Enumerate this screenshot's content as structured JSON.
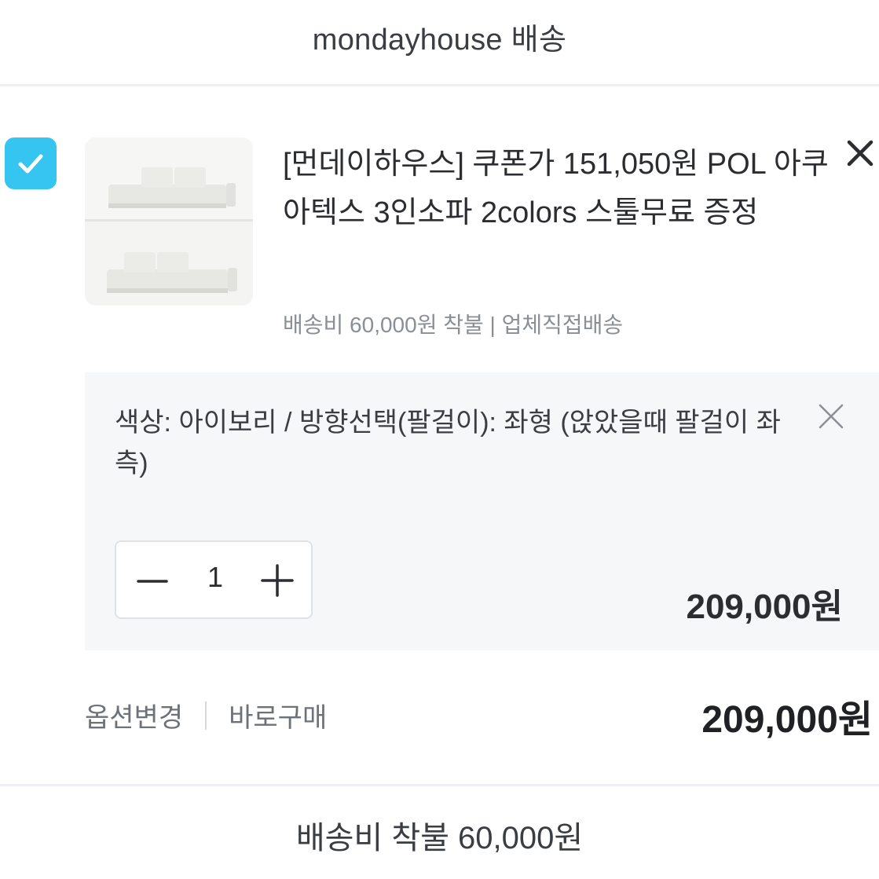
{
  "header": {
    "title": "mondayhouse 배송"
  },
  "item": {
    "checked": true,
    "thumbnail_alt": "sofa-product-image",
    "title": "[먼데이하우스] 쿠폰가 151,050원 POL 아쿠아텍스 3인소파 2colors 스툴무료 증정",
    "shipping": "배송비 60,000원 착불 | 업체직접배송"
  },
  "option": {
    "text": "색상: 아이보리 / 방향선택(팔걸이): 좌형 (앉았을때 팔걸이 좌측)",
    "quantity": "1",
    "price": "209,000원"
  },
  "actions": {
    "change_option": "옵션변경",
    "buy_now": "바로구매"
  },
  "total": {
    "price": "209,000원"
  },
  "footer": {
    "shipping_text": "배송비 착불 60,000원"
  },
  "colors": {
    "accent": "#35c5f0",
    "option_bg": "#f5f7f9",
    "divider": "#eef0f3"
  },
  "icons": [
    "check-icon",
    "close-icon",
    "minus-icon",
    "plus-icon"
  ]
}
